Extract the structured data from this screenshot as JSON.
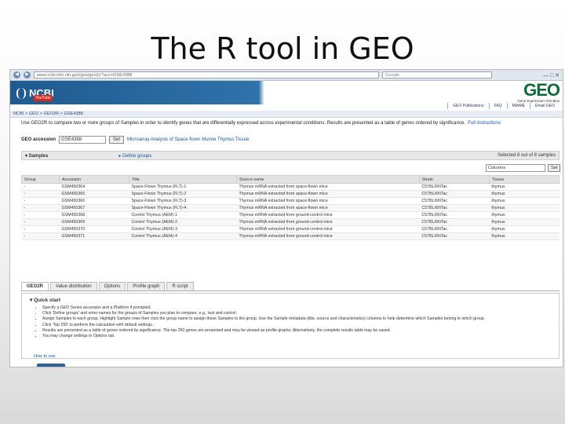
{
  "slide": {
    "title": "The R tool in GEO"
  },
  "browser": {
    "url": "www.ncbi.nlm.nih.gov/geo/geo2r/?acc=GSE4388",
    "search_placeholder": "Google",
    "back": "◀",
    "forward": "▶"
  },
  "header": {
    "ncbi_logo": "NCBI",
    "geo_logo": "GEO",
    "geo_tagline": "Gene Expression Omnibus",
    "youtube": "YouTube",
    "links": [
      "GEO Publications",
      "FAQ",
      "MIAME",
      "Email GEO"
    ],
    "breadcrumb": "NCBI > GEO > GEO2R > GSE4388"
  },
  "intro": {
    "text": "Use GEO2R to compare two or more groups of Samples in order to identify genes that are differentially expressed across experimental conditions. Results are presented as a table of genes ordered by significance.",
    "link": "Full instructions"
  },
  "accession": {
    "label": "GEO accession",
    "value": "GSE4388",
    "button": "Set",
    "study_title": "Microarray Analysis of Space-flown Murine Thymus Tissue"
  },
  "samples": {
    "title": "▾ Samples",
    "define_groups": "▸ Define groups",
    "selected": "Selected 8 out of 8 samples",
    "columns_select": "Columns",
    "columns_button": "Set",
    "headers": [
      "Group",
      "Accession",
      "Title",
      "Source name",
      "Strain",
      "Tissue"
    ],
    "rows": [
      [
        "-",
        "GSM450364",
        "Space-Flown Thymus (FLT)-1",
        "Thymus mRNA extracted from space-flown mice",
        "C57BL/6NTac",
        "thymus"
      ],
      [
        "-",
        "GSM450365",
        "Space-Flown Thymus (FLT)-2",
        "Thymus mRNA extracted from space-flown mice",
        "C57BL/6NTac",
        "thymus"
      ],
      [
        "-",
        "GSM450366",
        "Space-Flown Thymus (FLT)-3",
        "Thymus mRNA extracted from space-flown mice",
        "C57BL/6NTac",
        "thymus"
      ],
      [
        "-",
        "GSM450367",
        "Space-Flown Thymus (FLT)-4",
        "Thymus mRNA extracted from space-flown mice",
        "C57BL/6NTac",
        "thymus"
      ],
      [
        "-",
        "GSM450368",
        "Control Thymus (AEM)-1",
        "Thymus mRNA extracted from ground-control mice",
        "C57BL/6NTac",
        "thymus"
      ],
      [
        "-",
        "GSM450369",
        "Control Thymus (AEM)-2",
        "Thymus mRNA extracted from ground-control mice",
        "C57BL/6NTac",
        "thymus"
      ],
      [
        "-",
        "GSM450370",
        "Control Thymus (AEM)-3",
        "Thymus mRNA extracted from ground-control mice",
        "C57BL/6NTac",
        "thymus"
      ],
      [
        "-",
        "GSM450371",
        "Control Thymus (AEM)-4",
        "Thymus mRNA extracted from ground-control mice",
        "C57BL/6NTac",
        "thymus"
      ]
    ]
  },
  "tabs": [
    "GEO2R",
    "Value distribution",
    "Options",
    "Profile graph",
    "R script"
  ],
  "quick_start": {
    "title": "▾ Quick start",
    "items": [
      "Specify a GEO Series accession and a Platform if prompted.",
      "Click 'Define groups' and enter names for the groups of Samples you plan to compare, e.g., test and control.",
      "Assign Samples to each group. Highlight Sample rows then click the group name to assign those Samples to the group. Use the Sample metadata (title, source and characteristics) columns to help determine which Samples belong to which group.",
      "Click 'Top 250' to perform the calculation with default settings.",
      "Results are presented as a table of genes ordered by significance. The top 250 genes are presented and may be viewed as profile graphs. Alternatively, the complete results table may be saved.",
      "You may change settings in Options tab."
    ],
    "how_to": "How to use"
  }
}
